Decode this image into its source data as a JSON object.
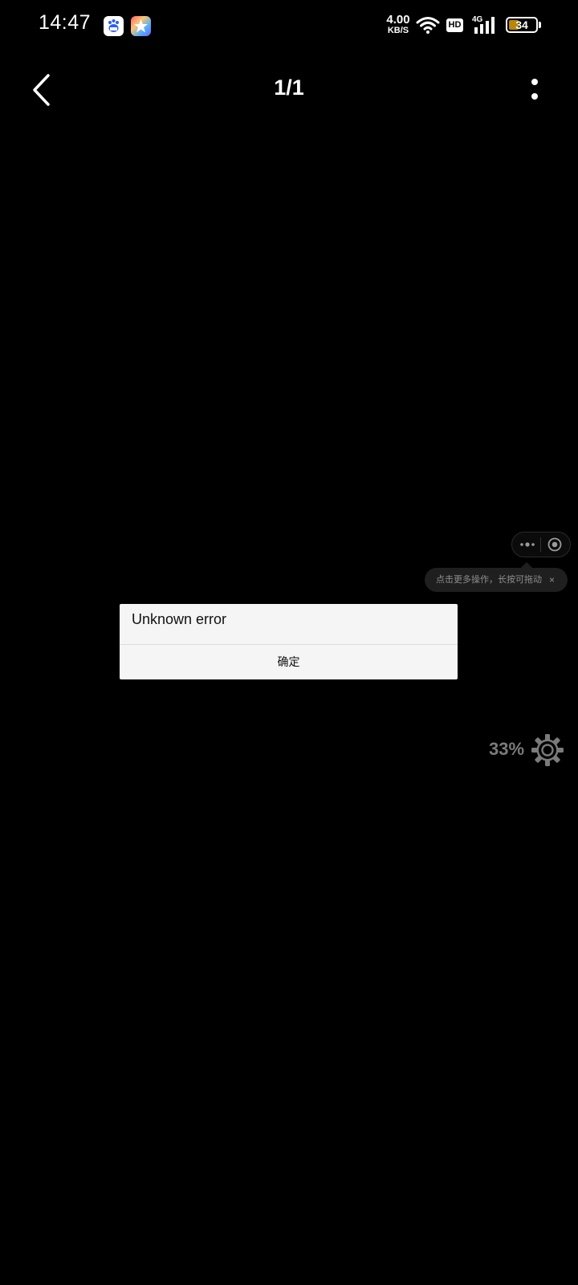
{
  "status_bar": {
    "time": "14:47",
    "net_speed_value": "4.00",
    "net_speed_unit": "KB/S",
    "hd_label": "HD",
    "network_type": "4G",
    "battery_level": "34",
    "icons": [
      "baidu-maps-icon",
      "star-app-icon",
      "wifi-icon",
      "hd-icon",
      "signal-4g-icon",
      "battery-icon"
    ]
  },
  "nav": {
    "page_counter": "1/1",
    "back_icon": "chevron-left-icon",
    "more_icon": "more-vertical-icon"
  },
  "capsule": {
    "more_icon": "more-dots-icon",
    "close_icon": "target-circle-icon"
  },
  "tooltip": {
    "text": "点击更多操作，长按可拖动",
    "close_symbol": "×"
  },
  "dialog": {
    "message": "Unknown error",
    "confirm_label": "确定"
  },
  "loading": {
    "progress_text": "33%",
    "icon": "gear-icon"
  },
  "colors": {
    "background": "#000000",
    "dialog_background": "#f5f5f5",
    "tooltip_background": "#1f1f1f",
    "muted_text": "#7b7b7b",
    "battery_fill": "#b8860b"
  }
}
